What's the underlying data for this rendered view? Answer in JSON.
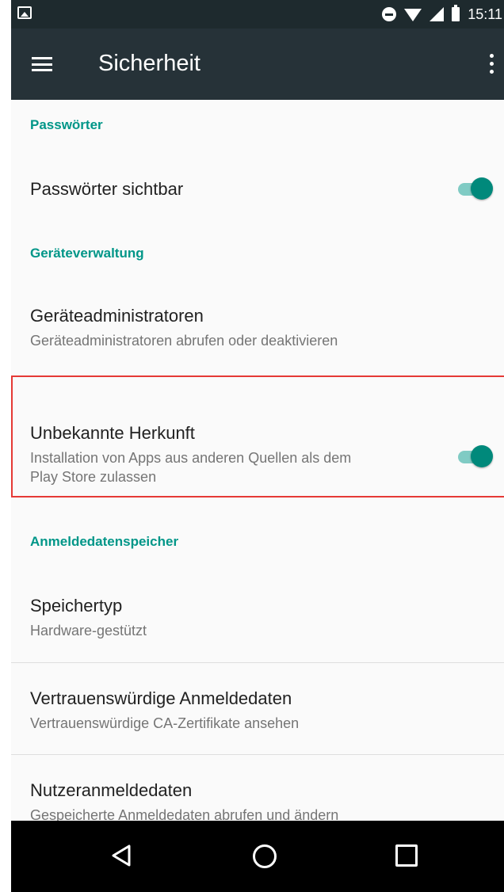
{
  "statusbar": {
    "time": "15:11"
  },
  "appbar": {
    "title": "Sicherheit"
  },
  "sections": [
    {
      "category": "Passwörter",
      "items": [
        {
          "title": "Passwörter sichtbar",
          "toggle_on": true
        }
      ]
    },
    {
      "category": "Geräteverwaltung",
      "items": [
        {
          "title": "Geräteadministratoren",
          "subtitle": "Geräteadministratoren abrufen oder deaktivieren"
        },
        {
          "title": "Unbekannte Herkunft",
          "subtitle_line1": "Installation von Apps aus anderen Quellen als dem",
          "subtitle_line2": "Play Store zulassen",
          "toggle_on": true
        }
      ]
    },
    {
      "category": "Anmeldedatenspeicher",
      "items": [
        {
          "title": "Speichertyp",
          "subtitle": "Hardware-gestützt"
        },
        {
          "title": "Vertrauenswürdige Anmeldedaten",
          "subtitle": "Vertrauenswürdige CA-Zertifikate ansehen"
        },
        {
          "title": "Nutzeranmeldedaten",
          "subtitle": "Gespeicherte Anmeldedaten abrufen und ändern"
        }
      ]
    }
  ],
  "colors": {
    "accent": "#009688",
    "toggle_thumb": "#00897b",
    "toggle_track": "#80cbc4",
    "appbar": "#263238",
    "highlight": "#e53935"
  },
  "icons": {
    "menu": "hamburger-menu-icon",
    "more": "more-vert-icon",
    "back": "nav-back-icon",
    "home": "nav-home-icon",
    "recents": "nav-recents-icon"
  }
}
